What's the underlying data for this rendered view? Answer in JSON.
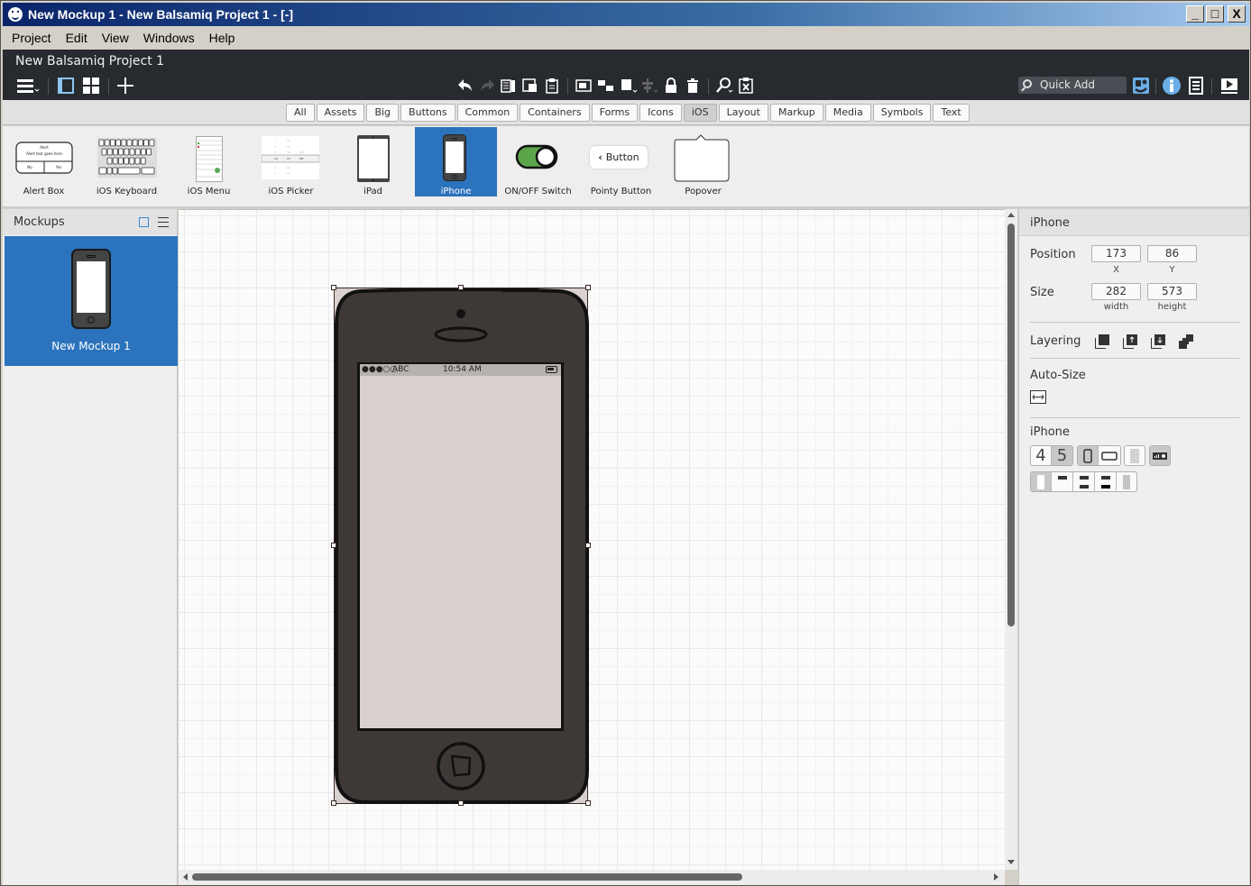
{
  "window": {
    "title": "New Mockup 1 - New Balsamiq Project 1 - [-]",
    "controls": {
      "minimize": "_",
      "maximize": "□",
      "close": "X"
    }
  },
  "menubar": [
    "Project",
    "Edit",
    "View",
    "Windows",
    "Help"
  ],
  "toolbar": {
    "project_name": "New Balsamiq Project 1",
    "left_icons": [
      "hamburger-menu-icon",
      "single-pane-icon",
      "grid-view-icon",
      "add-icon"
    ],
    "center_icons": [
      "undo-icon",
      "redo-icon",
      "copy-icon",
      "duplicate-icon",
      "paste-icon",
      "group-icon",
      "ungroup-icon",
      "arrange-icon",
      "align-icon",
      "lock-icon",
      "delete-icon",
      "find-icon",
      "clear-icon"
    ],
    "quick_add_placeholder": "Quick Add",
    "right_icons": [
      "symbols-icon",
      "info-icon",
      "notes-icon",
      "present-icon"
    ]
  },
  "library_tabs": {
    "items": [
      "All",
      "Assets",
      "Big",
      "Buttons",
      "Common",
      "Containers",
      "Forms",
      "Icons",
      "iOS",
      "Layout",
      "Markup",
      "Media",
      "Symbols",
      "Text"
    ],
    "active": "iOS"
  },
  "palette": {
    "items": [
      "Alert Box",
      "iOS Keyboard",
      "iOS Menu",
      "iOS Picker",
      "iPad",
      "iPhone",
      "ON/OFF Switch",
      "Pointy Button",
      "Popover"
    ],
    "selected": "iPhone",
    "alert_box": {
      "title": "Alert",
      "text": "Alert text goes here",
      "buttons": [
        "No",
        "Yes"
      ]
    },
    "pointy_button_label": "Button"
  },
  "mockups_panel": {
    "title": "Mockups",
    "items": [
      {
        "label": "New Mockup 1",
        "selected": true
      }
    ]
  },
  "canvas": {
    "iphone": {
      "signal": "●●●○○",
      "carrier": "ABC",
      "time": "10:54 AM"
    }
  },
  "inspector": {
    "title": "iPhone",
    "position_label": "Position",
    "x": "173",
    "y": "86",
    "x_label": "X",
    "y_label": "Y",
    "size_label": "Size",
    "width": "282",
    "height": "573",
    "width_label": "width",
    "height_label": "height",
    "layering_label": "Layering",
    "layering_icons": [
      "bring-to-front-icon",
      "bring-forward-icon",
      "send-backward-icon",
      "send-to-back-icon"
    ],
    "autosize_label": "Auto-Size",
    "section_label": "iPhone",
    "version_options": [
      "4",
      "5"
    ],
    "version_selected": "5",
    "orientation_options": [
      "portrait",
      "landscape"
    ],
    "orientation_selected": "portrait",
    "layout_options": [
      "full",
      "top-bar",
      "top-bottom-bars",
      "top-bottom-dark",
      "sidebar"
    ],
    "layout_selected": "full"
  }
}
